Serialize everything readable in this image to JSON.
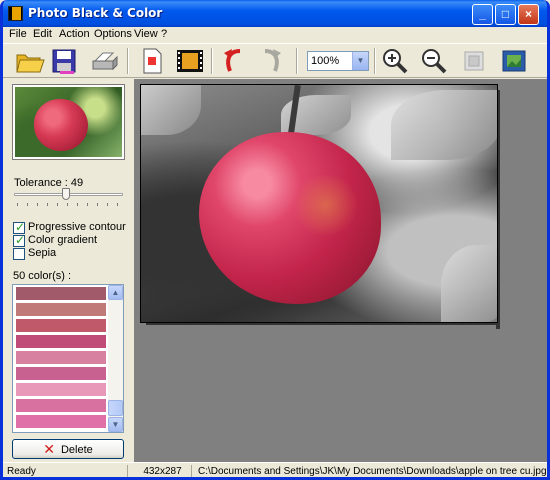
{
  "window": {
    "title": "Photo Black & Color"
  },
  "title_buttons": {
    "minimize": "_",
    "maximize": "□",
    "close": "×"
  },
  "menu": [
    "File",
    "Edit",
    "Action",
    "Options",
    "View",
    "?"
  ],
  "toolbar": {
    "buttons": [
      "open-icon",
      "save-icon",
      "print-icon",
      "new-document-icon",
      "filmstrip-icon",
      "undo-icon",
      "redo-icon",
      "zoom-in-icon",
      "zoom-out-icon",
      "fit-window-icon",
      "actual-size-icon"
    ],
    "zoom_value": "100%"
  },
  "left_panel": {
    "tolerance_label": "Tolerance : 49",
    "tolerance_value": 49,
    "checkboxes": [
      {
        "label": "Progressive contour",
        "checked": true
      },
      {
        "label": "Color gradient",
        "checked": true
      },
      {
        "label": "Sepia",
        "checked": false
      }
    ],
    "colors_label": "50 color(s) :",
    "swatches": [
      "#a05a6a",
      "#c07a78",
      "#c05a6a",
      "#c04a78",
      "#d880a0",
      "#c86090",
      "#e898b8",
      "#d870a0",
      "#e070a8"
    ],
    "delete_label": "Delete"
  },
  "status": {
    "state": "Ready",
    "dimensions": "432x287",
    "path": "C:\\Documents and Settings\\JK\\My Documents\\Downloads\\apple on tree cu.jpg"
  },
  "colors": {
    "title_bar": "#0058ee",
    "accent_check": "#21a121",
    "delete_x": "#d21c1c"
  }
}
